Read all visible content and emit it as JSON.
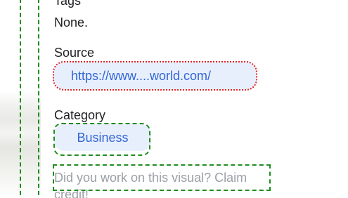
{
  "panel": {
    "tags_label": "Tags",
    "tags_value": "None.",
    "source_label": "Source",
    "source_link": "https://www....world.com/",
    "category_label": "Category",
    "category_chip": "Business",
    "claim_text": "Did you work on this visual? Claim credit!"
  },
  "colors": {
    "chip_background": "#e8effc",
    "chip_text": "#3367d6",
    "muted_text": "#9aa0a6",
    "highlight_dashed": "#1e8e1e",
    "highlight_dotted": "#e0212d"
  }
}
